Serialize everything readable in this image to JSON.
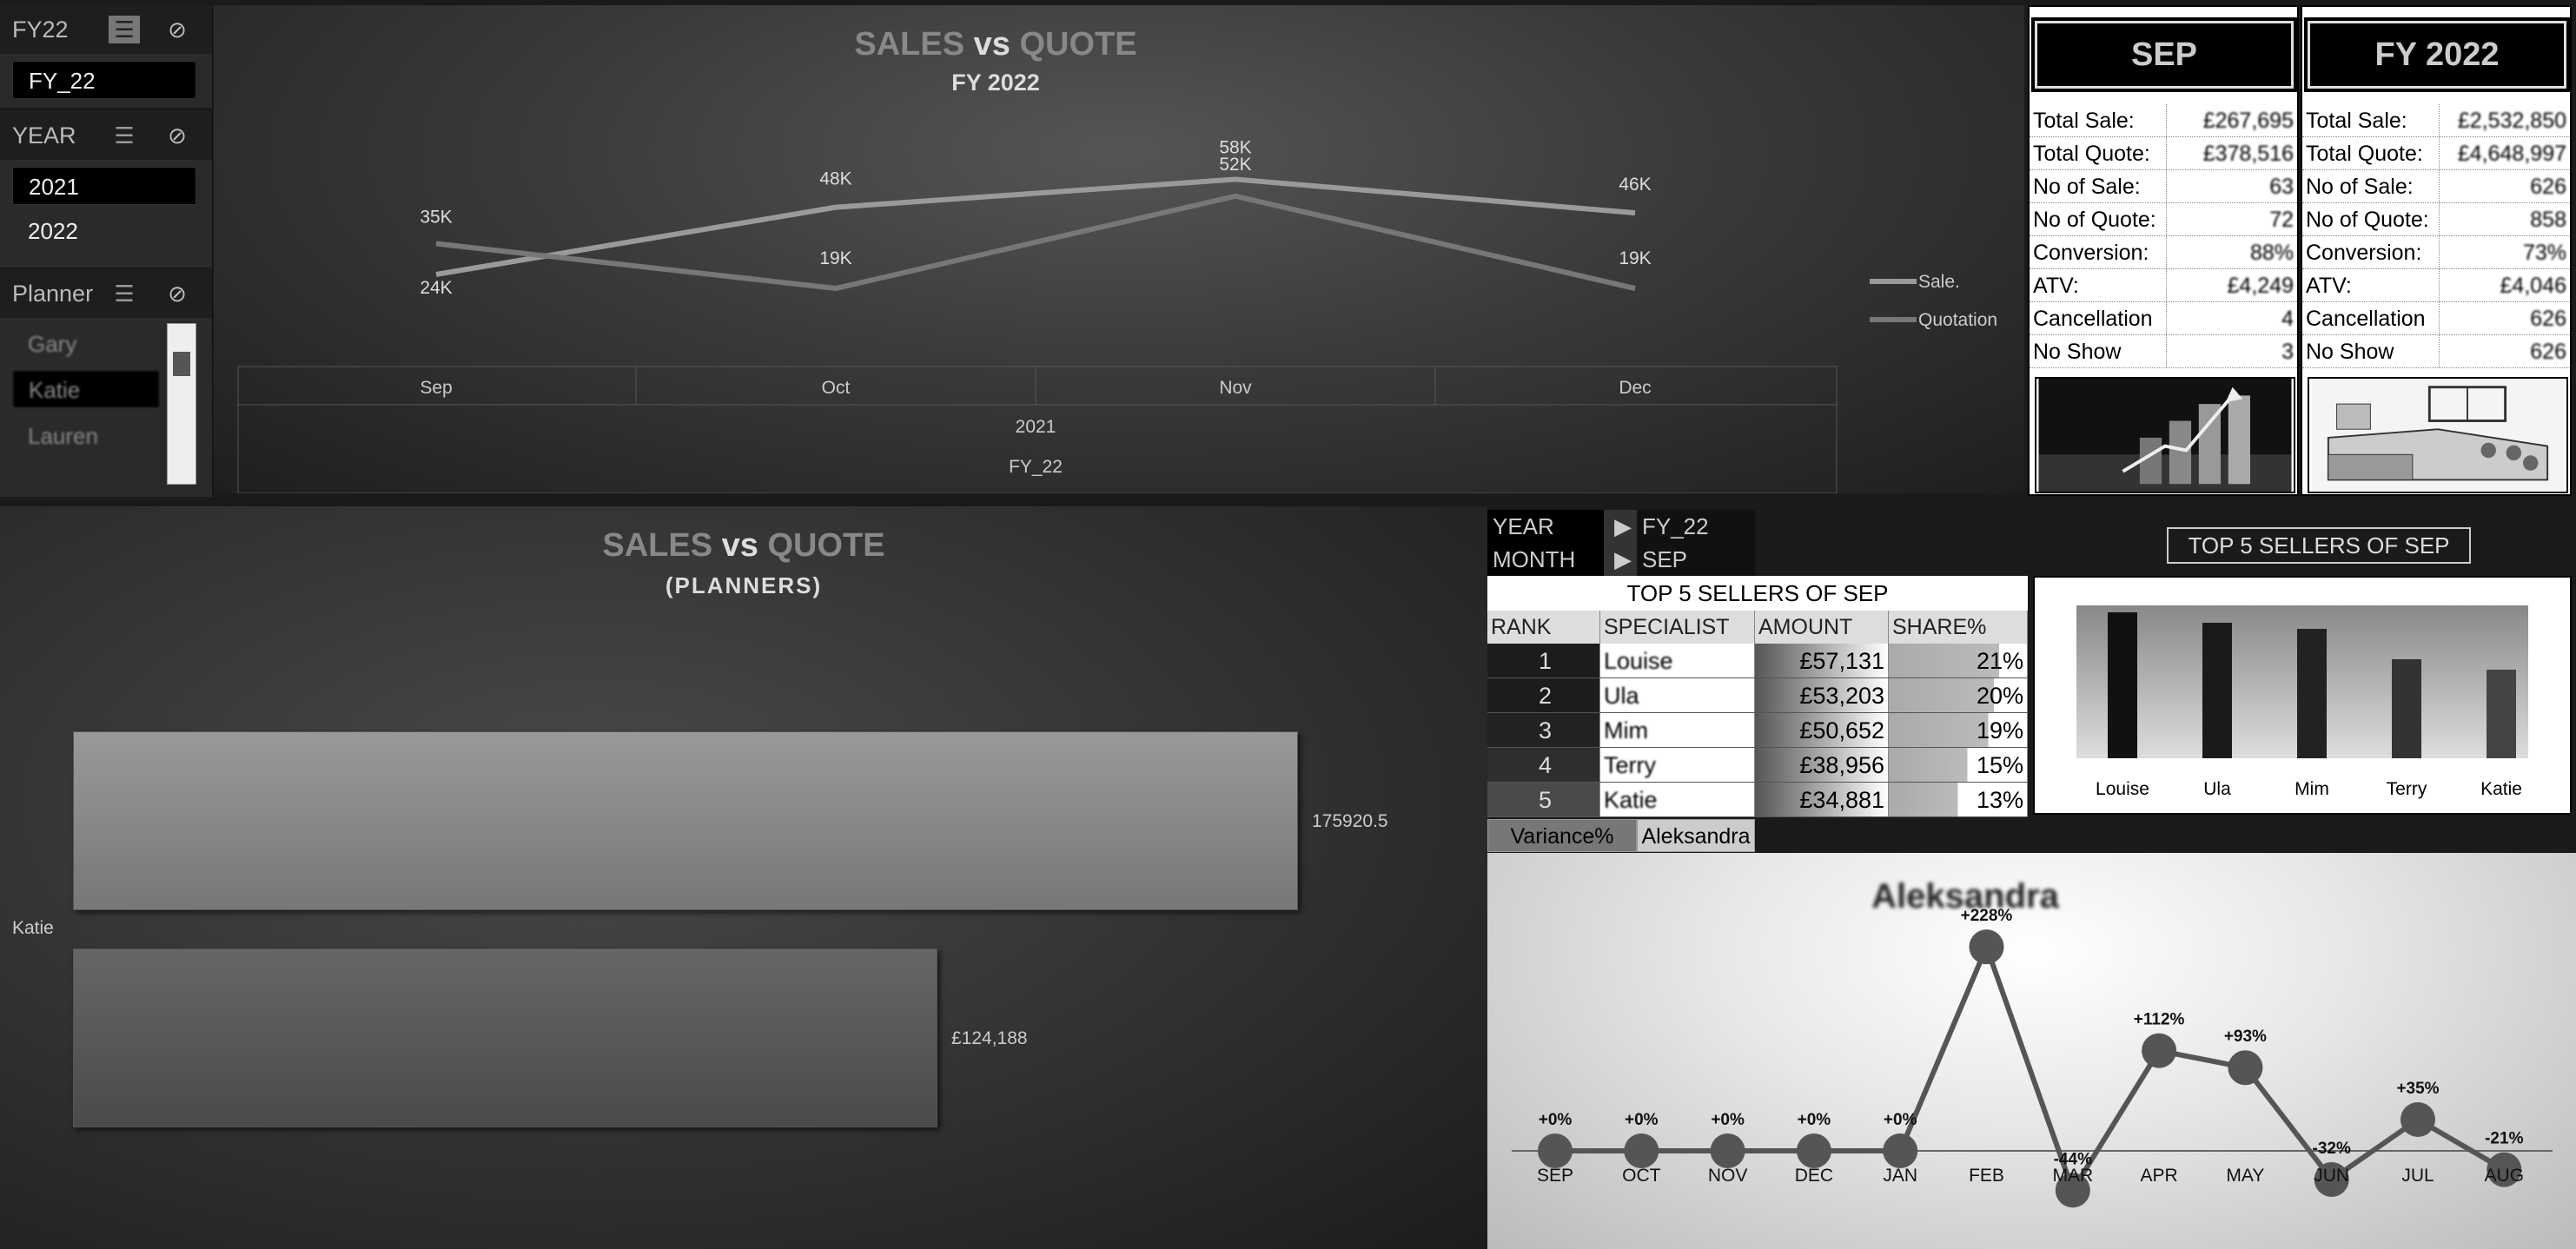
{
  "slicers": {
    "fy": {
      "title": "FY22",
      "items": [
        {
          "label": "FY_22",
          "selected": true
        }
      ]
    },
    "year": {
      "title": "YEAR",
      "items": [
        {
          "label": "2021",
          "selected": true
        },
        {
          "label": "2022",
          "selected": false
        }
      ]
    },
    "planner": {
      "title": "Planner",
      "items": [
        {
          "label": "Gary",
          "selected": false
        },
        {
          "label": "Katie",
          "selected": true
        },
        {
          "label": "Lauren",
          "selected": false
        }
      ]
    }
  },
  "top_chart": {
    "title_a": "SALES",
    "title_vs": "vs",
    "title_b": "QUOTE",
    "subtitle": "FY 2022",
    "chart_data": {
      "type": "line",
      "categories": [
        "Sep",
        "Oct",
        "Nov",
        "Dec"
      ],
      "series": [
        {
          "name": "Sale.",
          "values": [
            24000,
            48000,
            58000,
            46000
          ],
          "labels": [
            "24K",
            "48K",
            "58K",
            "46K"
          ]
        },
        {
          "name": "Quotation",
          "values": [
            35000,
            19000,
            52000,
            19000
          ],
          "labels": [
            "35K",
            "19K",
            "52K",
            "19K"
          ]
        }
      ],
      "axis_group_1": "2021",
      "axis_group_2": "FY_22",
      "legend": "right"
    }
  },
  "kpi_sep": {
    "header": "SEP",
    "rows": [
      {
        "label": "Total Sale:",
        "value": "£267,695"
      },
      {
        "label": "Total Quote:",
        "value": "£378,516"
      },
      {
        "label": "No of Sale:",
        "value": "63"
      },
      {
        "label": "No of Quote:",
        "value": "72"
      },
      {
        "label": "Conversion:",
        "value": "88%"
      },
      {
        "label": "ATV:",
        "value": "£4,249"
      },
      {
        "label": "Cancellation",
        "value": "4"
      },
      {
        "label": "No Show",
        "value": "3"
      }
    ]
  },
  "kpi_fy": {
    "header": "FY 2022",
    "rows": [
      {
        "label": "Total Sale:",
        "value": "£2,532,850"
      },
      {
        "label": "Total Quote:",
        "value": "£4,648,997"
      },
      {
        "label": "No of Sale:",
        "value": "626"
      },
      {
        "label": "No of Quote:",
        "value": "858"
      },
      {
        "label": "Conversion:",
        "value": "73%"
      },
      {
        "label": "ATV:",
        "value": "£4,046"
      },
      {
        "label": "Cancellation",
        "value": "626"
      },
      {
        "label": "No Show",
        "value": "626"
      }
    ]
  },
  "planner_chart": {
    "title_a": "SALES",
    "title_vs": "vs",
    "title_b": "QUOTE",
    "subtitle": "(PLANNERS)",
    "chart_data": {
      "type": "bar",
      "categories": [
        "Katie"
      ],
      "series": [
        {
          "values": [
            175920.5
          ],
          "label": "175920.5"
        },
        {
          "values": [
            124188
          ],
          "label": "£124,188"
        }
      ],
      "xlim": [
        0,
        190000
      ]
    }
  },
  "filters": {
    "year_label": "YEAR",
    "year_value": "FY_22",
    "month_label": "MONTH",
    "month_value": "SEP"
  },
  "top5": {
    "title": "TOP 5 SELLERS OF SEP",
    "headers": [
      "RANK",
      "SPECIALIST",
      "AMOUNT",
      "SHARE%"
    ],
    "rows": [
      {
        "rank": "1",
        "name": "Louise",
        "amount": "£57,131",
        "share": "21%",
        "share_value": 0.21
      },
      {
        "rank": "2",
        "name": "Ula",
        "amount": "£53,203",
        "share": "20%",
        "share_value": 0.2
      },
      {
        "rank": "3",
        "name": "Mim",
        "amount": "£50,652",
        "share": "19%",
        "share_value": 0.19
      },
      {
        "rank": "4",
        "name": "Terry",
        "amount": "£38,956",
        "share": "15%",
        "share_value": 0.15
      },
      {
        "rank": "5",
        "name": "Katie",
        "amount": "£34,881",
        "share": "13%",
        "share_value": 0.13
      }
    ],
    "variance_label": "Variance%",
    "variance_name": "Aleksandra"
  },
  "top5_chart": {
    "title": "TOP 5 SELLERS OF SEP",
    "chart_data": {
      "type": "bar",
      "categories": [
        "Louise",
        "Ula",
        "Mim",
        "Terry",
        "Katie"
      ],
      "values": [
        57131,
        53203,
        50652,
        38956,
        34881
      ],
      "ylim": [
        0,
        60000
      ]
    }
  },
  "variance_chart": {
    "title": "Aleksandra",
    "chart_data": {
      "type": "line",
      "categories": [
        "SEP",
        "OCT",
        "NOV",
        "DEC",
        "JAN",
        "FEB",
        "MAR",
        "APR",
        "MAY",
        "JUN",
        "JUL",
        "AUG"
      ],
      "values": [
        0,
        0,
        0,
        0,
        0,
        228,
        -44,
        112,
        93,
        -32,
        35,
        -21
      ],
      "labels": [
        "+0%",
        "+0%",
        "+0%",
        "+0%",
        "+0%",
        "+228%",
        "-44%",
        "+112%",
        "+93%",
        "-32%",
        "+35%",
        "-21%"
      ],
      "ylim": [
        -60,
        240
      ]
    }
  }
}
